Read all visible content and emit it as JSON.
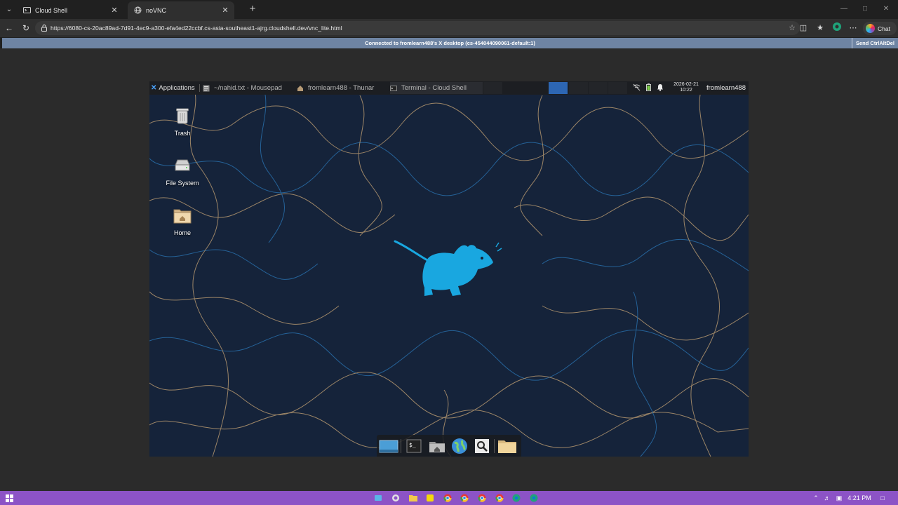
{
  "browser": {
    "tabs": [
      {
        "title": "Cloud Shell",
        "active": false
      },
      {
        "title": "noVNC",
        "active": true
      }
    ],
    "url": "https://6080-cs-20ac89ad-7d91-4ec9-a300-efa4ed22ccbf.cs-asia-southeast1-ajrg.cloudshell.dev/vnc_lite.html",
    "chat_label": "Chat"
  },
  "novnc": {
    "status": "Connected to fromlearn488's X desktop (cs-454044090061-default:1)",
    "send_cad_label": "Send CtrlAltDel"
  },
  "xfce": {
    "panel": {
      "applications_label": "Applications",
      "tasks": [
        {
          "title": "~/nahid.txt - Mousepad",
          "icon": "mousepad-icon"
        },
        {
          "title": "fromlearn488 - Thunar",
          "icon": "home-folder-icon"
        },
        {
          "title": "Terminal - Cloud Shell",
          "icon": "terminal-icon"
        }
      ],
      "date": "2026-02-21",
      "time": "10:22",
      "user": "fromlearn488"
    },
    "desktop_icons": [
      {
        "label": "Trash",
        "icon": "trash-icon"
      },
      {
        "label": "File System",
        "icon": "drive-icon"
      },
      {
        "label": "Home",
        "icon": "home-folder-icon"
      }
    ],
    "dock": [
      "show-desktop-icon",
      "terminal-icon",
      "file-manager-icon",
      "web-browser-icon",
      "app-finder-icon",
      "folder-icon"
    ]
  },
  "windows_taskbar": {
    "time": "4:21 PM"
  },
  "colors": {
    "vnc_bar": "#6e84a3",
    "xfce_mouse": "#19a7e0",
    "taskbar": "#8c53c6",
    "workspace_active": "#2d66b3"
  }
}
